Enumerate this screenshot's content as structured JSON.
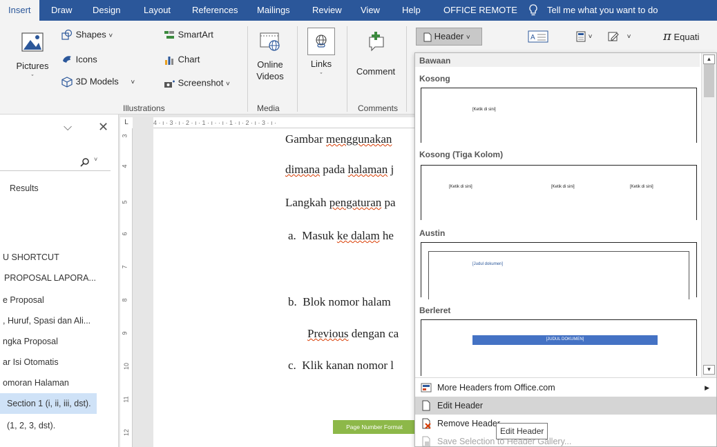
{
  "tabs": [
    "Insert",
    "Draw",
    "Design",
    "Layout",
    "References",
    "Mailings",
    "Review",
    "View",
    "Help",
    "OFFICE REMOTE"
  ],
  "tell_me": "Tell me what you want to do",
  "ribbon": {
    "pictures": "Pictures",
    "shapes": "Shapes",
    "icons": "Icons",
    "models3d": "3D Models",
    "smartart": "SmartArt",
    "chart": "Chart",
    "screenshot": "Screenshot",
    "online_videos_1": "Online",
    "online_videos_2": "Videos",
    "links": "Links",
    "comment": "Comment",
    "header": "Header",
    "equation": "Equati",
    "group_illustrations": "Illustrations",
    "group_media": "Media",
    "group_comments": "Comments"
  },
  "nav": {
    "results": "Results",
    "items": [
      "U SHORTCUT",
      "PROPOSAL LAPORA...",
      "e Proposal",
      ", Huruf, Spasi dan Ali...",
      "ngka Proposal",
      "ar Isi Otomatis",
      "omoran Halaman",
      "Section 1 (i, ii, iii, dst).",
      "(1, 2, 3, dst)."
    ]
  },
  "ruler": {
    "h": "4 · ı · 3 · ı · 2 · ı · 1 · ı ·  · ı · 1 · ı · 2 · ı · 3 · ı ·",
    "v": [
      "3",
      "4",
      "5",
      "6",
      "7",
      "8",
      "9",
      "10",
      "11",
      "12"
    ]
  },
  "doc": {
    "l1a": "Gambar",
    "l1b": "menggunakan",
    "l2a": "dimana",
    "l2b": "pada",
    "l2c": "halaman",
    "l2d": "j",
    "l3a": "Langkah",
    "l3b": "pengaturan",
    "l3c": "pa",
    "l4m": "a.",
    "l4a": "Masuk",
    "l4b": "ke dalam",
    "l4c": "he",
    "l5m": "b.",
    "l5a": "Blok nomor halam",
    "l6a": "Previous",
    "l6b": "dengan ca",
    "l7m": "c.",
    "l7a": "Klik kanan nomor l",
    "page_number_format": "Page Number Format"
  },
  "dropdown": {
    "section": "Bawaan",
    "items": [
      {
        "title": "Kosong",
        "preview": [
          "[Ketik di sini]"
        ]
      },
      {
        "title": "Kosong (Tiga Kolom)",
        "preview": [
          "[Ketik di sini]",
          "[Ketik di sini]",
          "[Ketik di sini]"
        ]
      },
      {
        "title": "Austin",
        "preview": [
          "[Judul dokumen]"
        ]
      },
      {
        "title": "Berleret",
        "preview": [
          "[JUDUL DOKUMEN]"
        ]
      }
    ],
    "menu": {
      "more": "More Headers from Office.com",
      "edit": "Edit Header",
      "remove": "Remove Header",
      "save": "Save Selection to Header Gallery..."
    },
    "tooltip": "Edit Header"
  },
  "colors": {
    "ribbon_blue": "#2b579a",
    "berleret_bar": "#4472c4",
    "page_number_green": "#8db849"
  }
}
